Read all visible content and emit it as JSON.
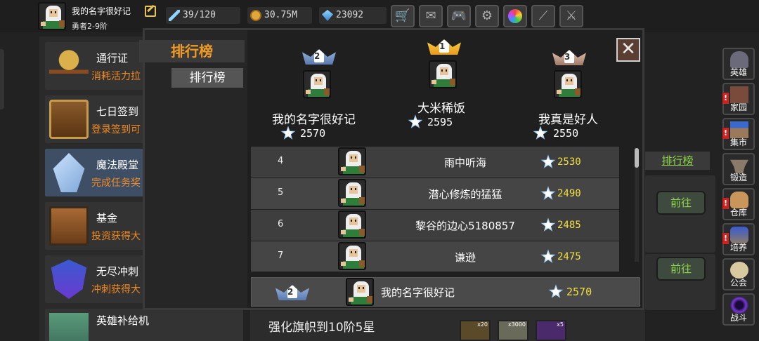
{
  "player": {
    "name": "我的名字很好记",
    "rank": "勇者2-9阶"
  },
  "stats": {
    "energy": "39/120",
    "gold": "30.75M",
    "gems": "23092"
  },
  "toolbar": [
    "shop-cart-icon",
    "mail-icon",
    "gamepad-icon",
    "gear-icon",
    "color-wheel-icon",
    "sword-icon",
    "crossed-swords-icon"
  ],
  "left_list": [
    {
      "title": "通行证",
      "desc": "消耗活力拉",
      "icon": "chalice-icon"
    },
    {
      "title": "七日签到",
      "desc": "登录签到可",
      "icon": "treasure-chest-icon"
    },
    {
      "title": "魔法殿堂",
      "desc": "完成任务奖",
      "icon": "crystal-icon"
    },
    {
      "title": "基金",
      "desc": "投资获得大",
      "icon": "coin-chest-icon"
    },
    {
      "title": "无尽冲刺",
      "desc": "冲刺获得大",
      "icon": "shield-icon"
    },
    {
      "title": "英雄补给机",
      "desc": "",
      "icon": "supply-machine-icon"
    }
  ],
  "leaderboard": {
    "tab_active": "排行榜",
    "tab": "排行榜",
    "close": "✕",
    "podium": [
      {
        "rank": "1",
        "name": "大米稀饭",
        "score": "2595"
      },
      {
        "rank": "2",
        "name": "我的名字很好记",
        "score": "2570"
      },
      {
        "rank": "3",
        "name": "我真是好人",
        "score": "2550"
      }
    ],
    "rows": [
      {
        "rank": "4",
        "name": "雨中听海",
        "score": "2530"
      },
      {
        "rank": "5",
        "name": "潜心修炼的猛猛",
        "score": "2490"
      },
      {
        "rank": "6",
        "name": "黎谷的边心5180857",
        "score": "2485"
      },
      {
        "rank": "7",
        "name": "谦逊",
        "score": "2475"
      }
    ],
    "me": {
      "rank": "2",
      "name": "我的名字很好记",
      "score": "2570"
    }
  },
  "right_panel": {
    "tab": "排行榜",
    "go1": "前往",
    "go2": "前往"
  },
  "task": {
    "text": "强化旗帜到10阶5星",
    "rewards": [
      "x20",
      "x3000",
      "x5"
    ]
  },
  "side_menu": [
    {
      "label": "英雄",
      "alert": ""
    },
    {
      "label": "家园",
      "alert": "!"
    },
    {
      "label": "集市",
      "alert": "!"
    },
    {
      "label": "锻造",
      "alert": ""
    },
    {
      "label": "仓库",
      "alert": "!"
    },
    {
      "label": "培养",
      "alert": "!"
    },
    {
      "label": "公会",
      "alert": ""
    },
    {
      "label": "战斗",
      "alert": ""
    }
  ],
  "colors": {
    "accent_orange": "#f29b22",
    "score_yellow": "#f0e040",
    "green": "#8ed64a",
    "alert_red": "#cc2222"
  }
}
